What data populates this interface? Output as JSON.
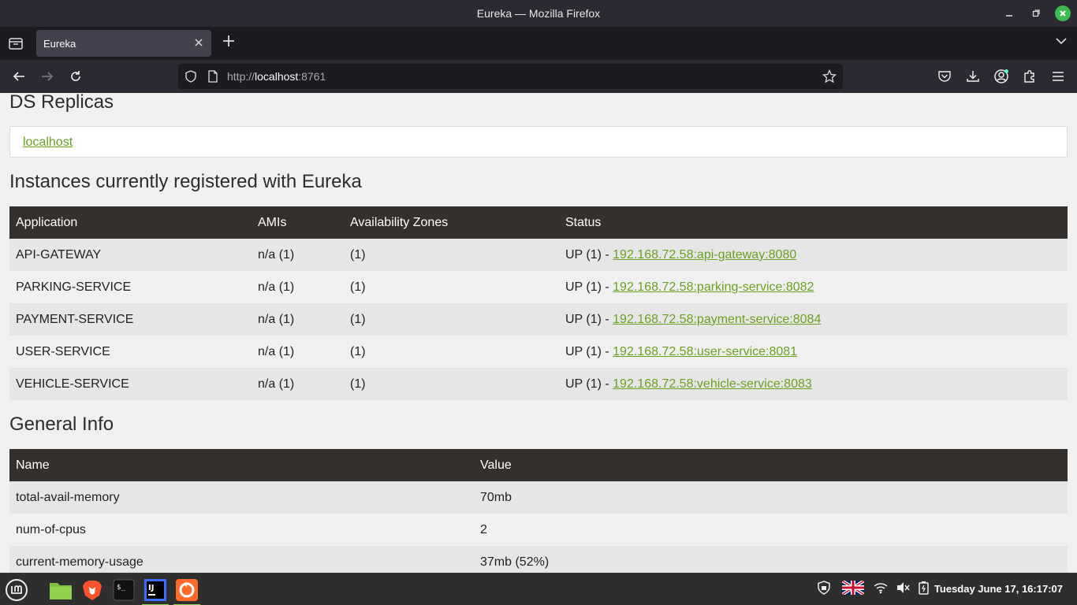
{
  "window": {
    "title": "Eureka — Mozilla Firefox"
  },
  "browser": {
    "tab_title": "Eureka",
    "url_scheme": "http://",
    "url_host": "localhost",
    "url_port": ":8761"
  },
  "page": {
    "replicas_heading": "DS Replicas",
    "replica_link": "localhost",
    "instances_heading": "Instances currently registered with Eureka",
    "instances_table": {
      "headers": [
        "Application",
        "AMIs",
        "Availability Zones",
        "Status"
      ],
      "rows": [
        {
          "app": "API-GATEWAY",
          "amis": "n/a (1)",
          "zones": "(1)",
          "status_prefix": "UP (1) - ",
          "status_link": "192.168.72.58:api-gateway:8080"
        },
        {
          "app": "PARKING-SERVICE",
          "amis": "n/a (1)",
          "zones": "(1)",
          "status_prefix": "UP (1) - ",
          "status_link": "192.168.72.58:parking-service:8082"
        },
        {
          "app": "PAYMENT-SERVICE",
          "amis": "n/a (1)",
          "zones": "(1)",
          "status_prefix": "UP (1) - ",
          "status_link": "192.168.72.58:payment-service:8084"
        },
        {
          "app": "USER-SERVICE",
          "amis": "n/a (1)",
          "zones": "(1)",
          "status_prefix": "UP (1) - ",
          "status_link": "192.168.72.58:user-service:8081"
        },
        {
          "app": "VEHICLE-SERVICE",
          "amis": "n/a (1)",
          "zones": "(1)",
          "status_prefix": "UP (1) - ",
          "status_link": "192.168.72.58:vehicle-service:8083"
        }
      ]
    },
    "general_heading": "General Info",
    "general_table": {
      "headers": [
        "Name",
        "Value"
      ],
      "rows": [
        {
          "name": "total-avail-memory",
          "value": "70mb"
        },
        {
          "name": "num-of-cpus",
          "value": "2"
        },
        {
          "name": "current-memory-usage",
          "value": "37mb (52%)"
        }
      ]
    }
  },
  "taskbar": {
    "clock": "Tuesday June 17, 16:17:07",
    "apps": [
      "menu-icon",
      "files-icon",
      "brave-icon",
      "terminal-icon",
      "intellij-icon",
      "firefox-icon"
    ]
  },
  "colors": {
    "link": "#6aa122",
    "table_header": "#34302d",
    "chrome_dark": "#2b2a33"
  }
}
